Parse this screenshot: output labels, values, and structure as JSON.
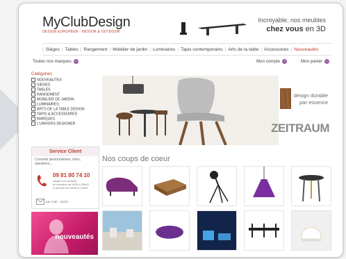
{
  "header": {
    "logo": "MyClubDesign",
    "tagline": "DESIGN EUROPÉEN - INDOOR & OUTDOOR",
    "banner_line1": "Incroyable, nos meubles",
    "banner_line2_bold": "chez vous",
    "banner_line2_rest": " en 3D"
  },
  "nav": {
    "items": [
      "Sièges",
      "Tables",
      "Rangement",
      "Mobilier de jardin",
      "Luminaires",
      "Tapis contemporains",
      "Arts de la table",
      "Accessoires",
      "Nouveautés"
    ]
  },
  "toolbar": {
    "brands": "Toutes nos marques",
    "account": "Mon compte",
    "cart": "Mon panier"
  },
  "sidebar": {
    "title": "Catégories",
    "items": [
      "NOUVEAUTES",
      "SIEGES",
      "TABLES",
      "RANGEMENT",
      "MOBILIER DE JARDIN",
      "LUMINAIRES",
      "ARTS DE LA TABLE DESIGN",
      "TAPIS & ACCESSOIRES",
      "MARQUES",
      "L'UNIVERS DESIGNER"
    ]
  },
  "service": {
    "title": "Service Client",
    "desc": "Conseils personnalisés, infos, questions...",
    "phone": "09 81 80 74 10",
    "phone_note": "(appel non surtaxé)",
    "hours1": "en semaine de 9h30 à 20h00",
    "hours2": "le samedi de 10h00 à 13h00",
    "foot": "par mail - 24/24"
  },
  "promo": {
    "label": "nouveautés"
  },
  "hero": {
    "line1": "design durable",
    "line2": "par essence",
    "brand": "ZEITRAUM"
  },
  "favorites": {
    "title": "Nos coups de coeur"
  },
  "colors": {
    "accent": "#c0392b",
    "purple": "#9b5aa8"
  }
}
